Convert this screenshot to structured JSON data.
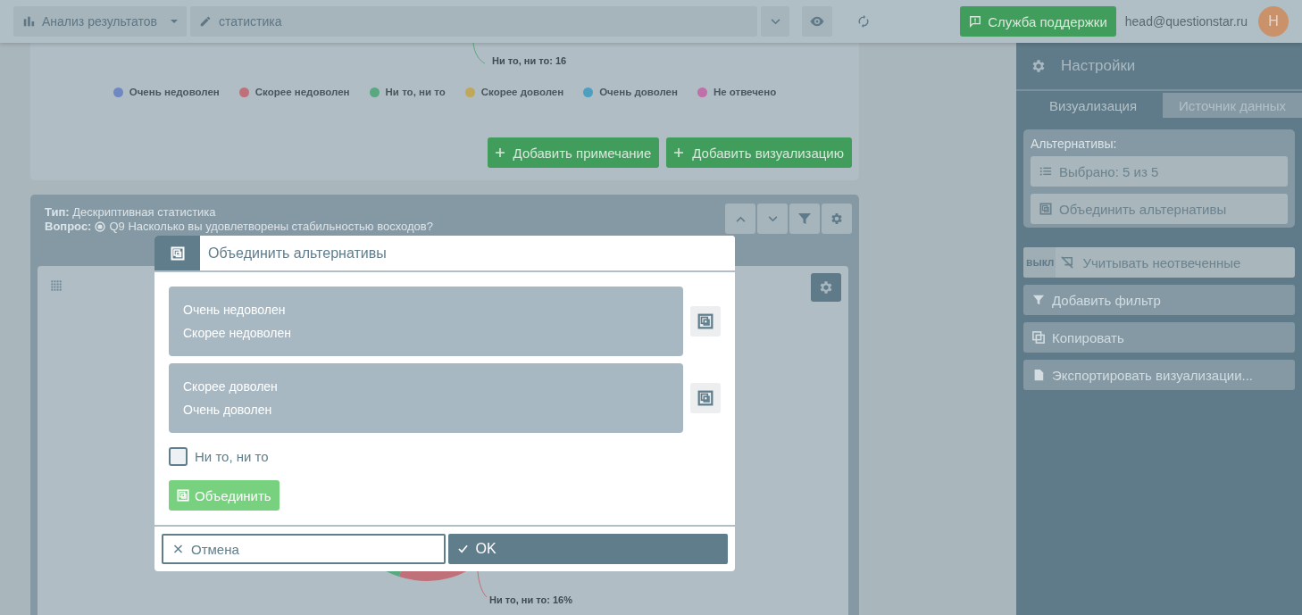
{
  "top_bar": {
    "section_menu": {
      "label": "Анализ результатов"
    },
    "name_field": {
      "value": "статистика"
    },
    "support_button": "Служба поддержки",
    "user_email": "head@questionstar.ru",
    "avatar_initial": "H"
  },
  "chart_card": {
    "data_label": "Ни то, ни то: 16",
    "legend": [
      {
        "label": "Очень недоволен",
        "color": "#7088c2"
      },
      {
        "label": "Скорее недоволен",
        "color": "#c07078"
      },
      {
        "label": "Ни то, ни то",
        "color": "#5aa87f"
      },
      {
        "label": "Скорее доволен",
        "color": "#bfa859"
      },
      {
        "label": "Очень доволен",
        "color": "#4d9fbf"
      },
      {
        "label": "Не отвечено",
        "color": "#c070a8"
      }
    ],
    "buttons": [
      "Добавить примечание",
      "Добавить визуализацию"
    ]
  },
  "stat_card": {
    "type_line": "**Тип:** Дескриптивная статистика",
    "question_label": "Вопрос:",
    "question_text": "Q9 Насколько вы удовлетворены стабильностью восходов?",
    "chart_label": "Ни то, ни то: 16%"
  },
  "settings_panel": {
    "title": "Настройки",
    "tabs": [
      {
        "label": "Визуализация",
        "selected": true
      },
      {
        "label": "Источник данных",
        "selected": false
      }
    ],
    "alternatives_label": "Альтернативы:",
    "alternatives_buttons": [
      {
        "kind": "list",
        "label": "Выбрано: 5 из 5"
      },
      {
        "kind": "merge",
        "label": "Объединить альтернативы"
      }
    ],
    "unanswered_toggle": {
      "state_label": "выкл",
      "label": "Учитывать неотвеченные",
      "on": false
    },
    "actions": [
      {
        "kind": "filter",
        "label": "Добавить фильтр",
        "disabled": true
      },
      {
        "kind": "copy",
        "label": "Копировать",
        "disabled": true
      },
      {
        "kind": "export",
        "label": "Экспортировать визуализации...",
        "disabled": true
      }
    ]
  },
  "dialog": {
    "title_field": {
      "value": "Объединить альтернативы"
    },
    "groups": [
      {
        "items": [
          "Очень недоволен",
          "Скорее недоволен"
        ]
      },
      {
        "items": [
          "Скорее доволен",
          "Очень доволен"
        ]
      }
    ],
    "ungrouped": [
      {
        "label": "Ни то, ни то",
        "checked": false
      }
    ],
    "merge_button": "Объединить",
    "cancel_button": "Отмена",
    "ok_button": "OK"
  }
}
